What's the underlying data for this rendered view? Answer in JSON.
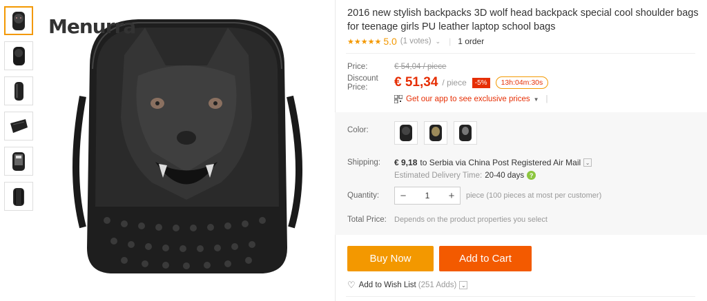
{
  "brand": "Menurra",
  "thumbnails": [
    {
      "name": "front"
    },
    {
      "name": "front-angle"
    },
    {
      "name": "side"
    },
    {
      "name": "top"
    },
    {
      "name": "open"
    },
    {
      "name": "back"
    }
  ],
  "product": {
    "title": "2016 new stylish backpacks 3D wolf head backpack special cool shoulder bags for teenage girls PU leather laptop school bags",
    "stars": "★★★★★",
    "rating": "5.0",
    "votes": "(1 votes)",
    "orders": "1 order"
  },
  "price": {
    "label": "Price:",
    "original": "€ 54,04 / piece",
    "discount_label_1": "Discount",
    "discount_label_2": "Price:",
    "discount_value": "€ 51,34",
    "unit": "/ piece",
    "discount_badge": "-5%",
    "timer": "13h:04m:30s",
    "app_promo": "Get our app to see exclusive prices"
  },
  "color": {
    "label": "Color:",
    "options": [
      "wolf",
      "tiger",
      "skull"
    ]
  },
  "shipping": {
    "label": "Shipping:",
    "cost": "€ 9,18",
    "route": "to Serbia via China Post Registered Air Mail",
    "delivery_label": "Estimated Delivery Time:",
    "delivery_days": "20-40 days"
  },
  "quantity": {
    "label": "Quantity:",
    "value": "1",
    "minus": "−",
    "plus": "+",
    "note": "piece (100 pieces at most per customer)"
  },
  "total": {
    "label": "Total Price:",
    "note": "Depends on the product properties you select"
  },
  "actions": {
    "buy_now": "Buy Now",
    "add_to_cart": "Add to Cart",
    "wish_list": "Add to Wish List",
    "wish_count": "(251 Adds)"
  },
  "colors": {
    "accent_orange": "#f39800",
    "cart_orange": "#f35a00",
    "price_red": "#e62e04"
  }
}
